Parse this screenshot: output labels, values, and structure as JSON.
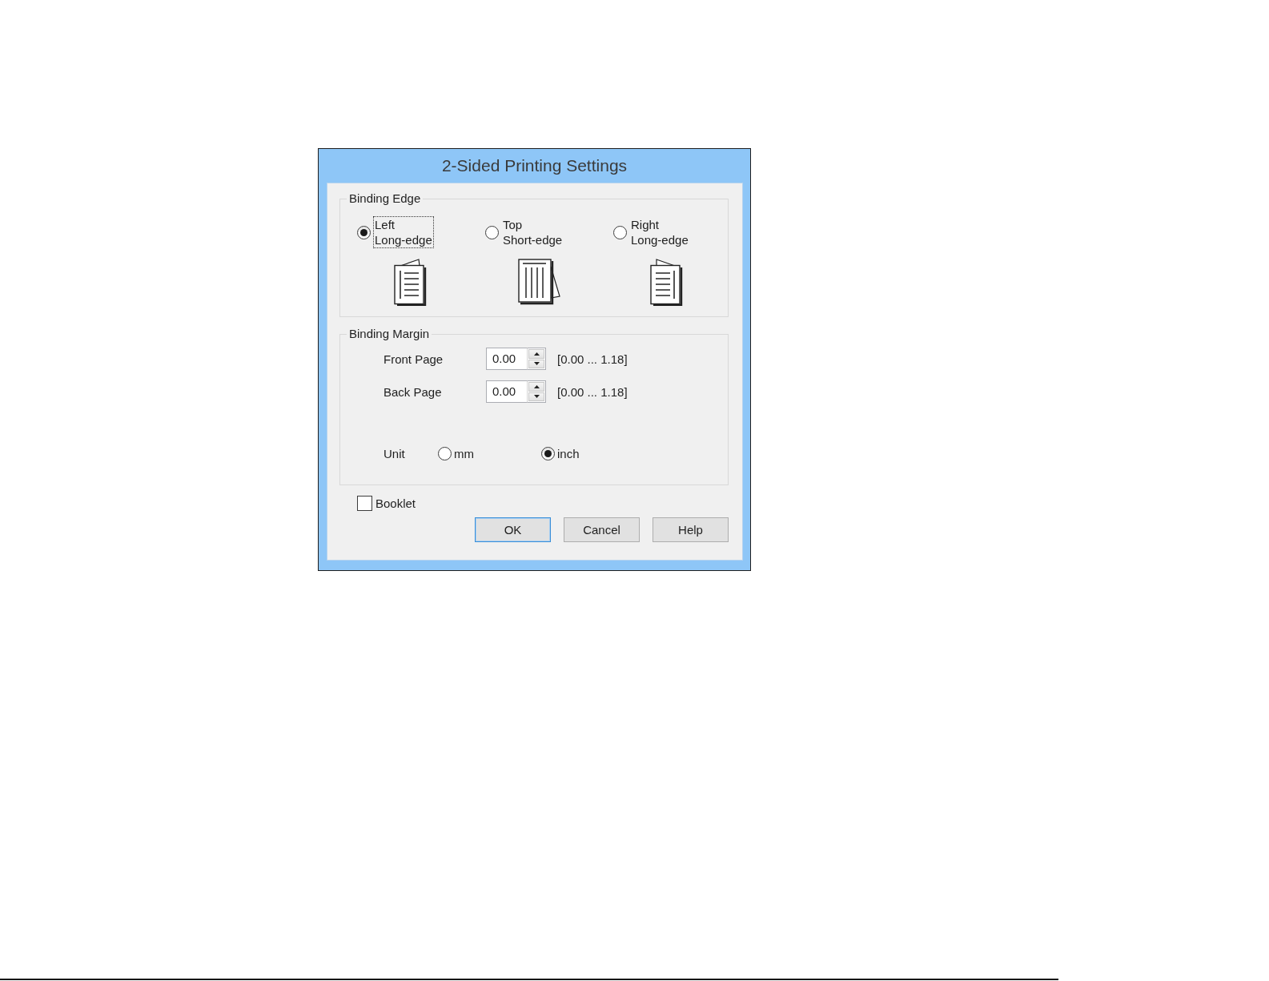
{
  "dialog": {
    "title": "2-Sided Printing Settings"
  },
  "binding_edge": {
    "label": "Binding Edge",
    "options": [
      {
        "kind": "left",
        "side": "Left",
        "edge": "Long-edge",
        "selected": true,
        "focused": true
      },
      {
        "kind": "top",
        "side": "Top",
        "edge": "Short-edge",
        "selected": false,
        "focused": false
      },
      {
        "kind": "right",
        "side": "Right",
        "edge": "Long-edge",
        "selected": false,
        "focused": false
      }
    ]
  },
  "binding_margin": {
    "label": "Binding Margin",
    "fields": [
      {
        "label": "Front Page",
        "value": "0.00",
        "range": "[0.00 ... 1.18]"
      },
      {
        "label": "Back Page",
        "value": "0.00",
        "range": "[0.00 ... 1.18]"
      }
    ],
    "unit": {
      "label": "Unit",
      "options": [
        {
          "label": "mm",
          "selected": false
        },
        {
          "label": "inch",
          "selected": true
        }
      ]
    }
  },
  "booklet": {
    "label": "Booklet",
    "checked": false
  },
  "buttons": [
    {
      "label": "OK",
      "default": true
    },
    {
      "label": "Cancel",
      "default": false
    },
    {
      "label": "Help",
      "default": false
    }
  ]
}
